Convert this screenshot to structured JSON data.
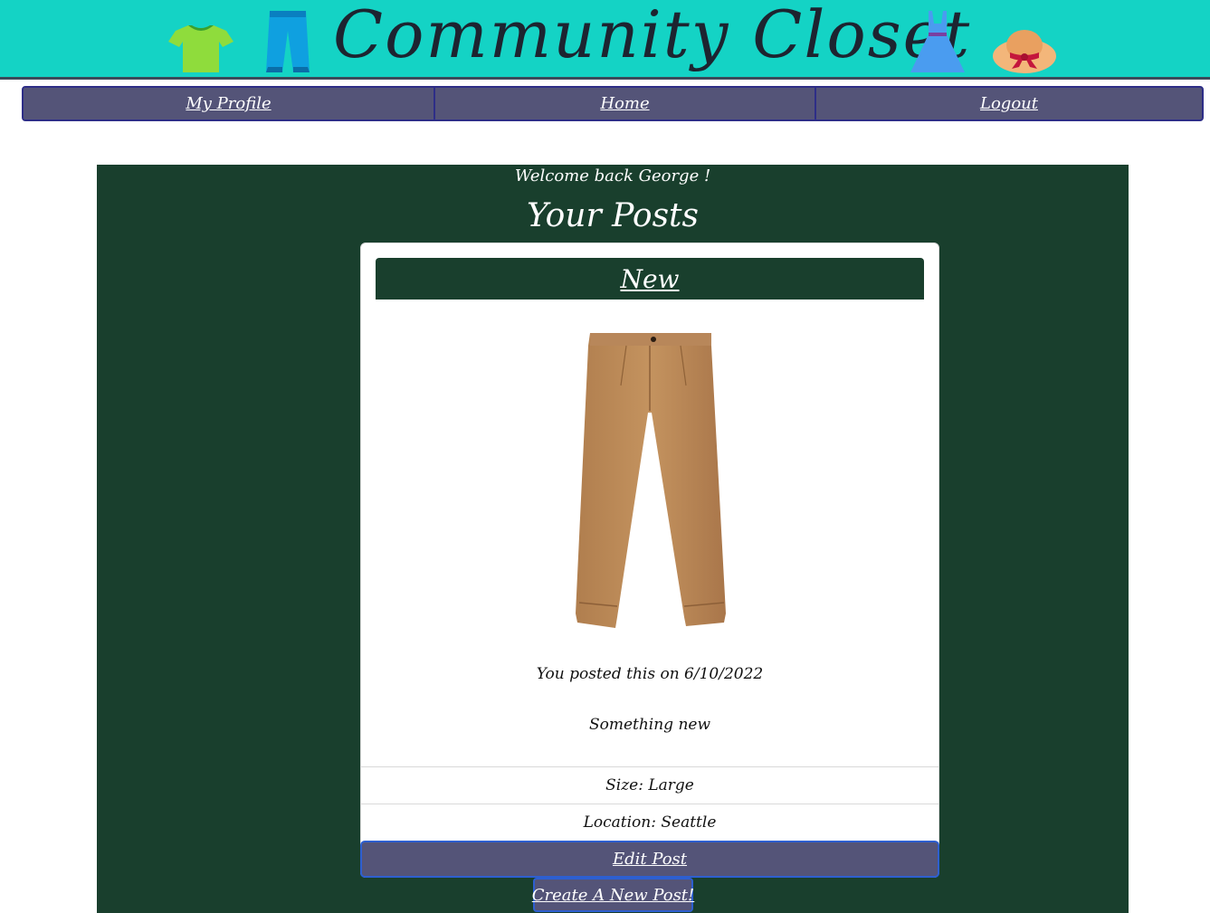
{
  "header": {
    "title": "Community Closet",
    "icons": [
      "shirt-icon",
      "pants-icon",
      "dress-icon",
      "hat-icon"
    ]
  },
  "nav": {
    "profile": "My Profile",
    "home": "Home",
    "logout": "Logout"
  },
  "main": {
    "welcome": "Welcome back George !",
    "heading": "Your Posts",
    "post": {
      "title": "New",
      "image": "khaki-pants-image",
      "posted": "You posted this on 6/10/2022",
      "description": "Something new",
      "size": "Size: Large",
      "location": "Location: Seattle",
      "edit_label": "Edit Post"
    },
    "create_label": "Create A New Post!"
  },
  "colors": {
    "header_bg": "#14d3c5",
    "nav_bg": "#545478",
    "panel_bg": "#193f2d",
    "card_bg": "#ffffff",
    "button_border": "#2e5fd0"
  }
}
